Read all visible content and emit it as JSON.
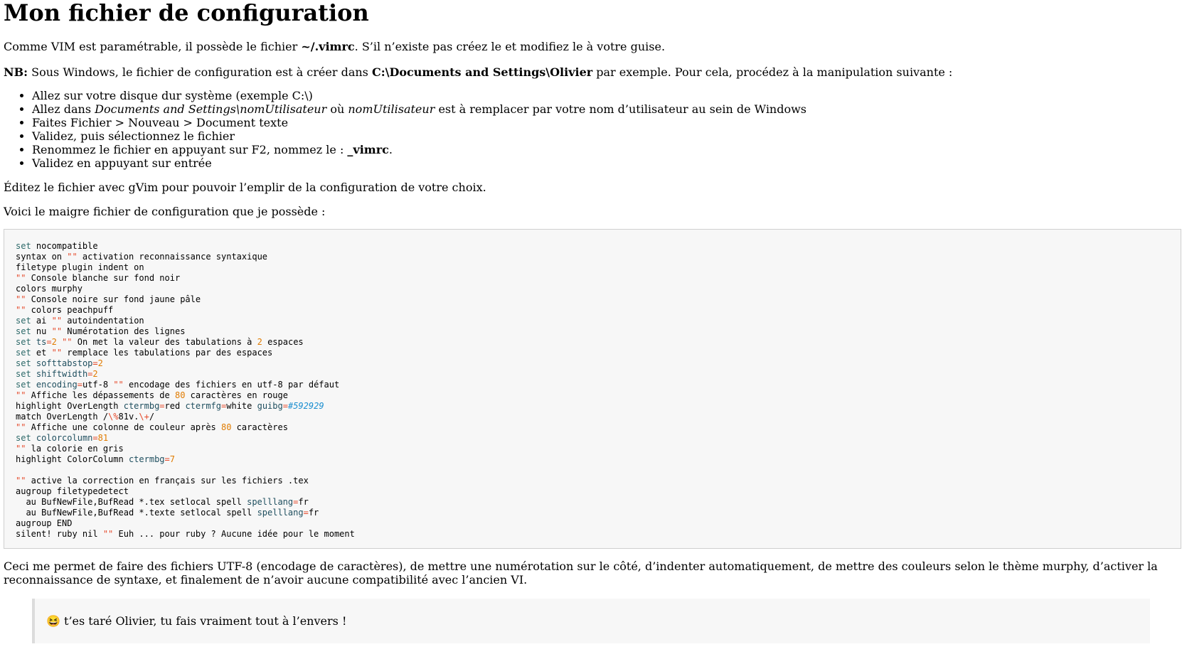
{
  "title": "Mon fichier de configuration",
  "intro": {
    "before": "Comme VIM est paramétrable, il possède le fichier ",
    "file": "~/.vimrc",
    "after": ". S’il n’existe pas créez le et modifiez le à votre guise."
  },
  "nb": {
    "label": "NB:",
    "before": " Sous Windows, le fichier de configuration est à créer dans ",
    "path": "C:\\Documents and Settings\\Olivier",
    "after": " par exemple. Pour cela, procédez à la manipulation suivante :"
  },
  "steps": {
    "s1": "Allez sur votre disque dur système (exemple C:\\)",
    "s2_a": "Allez dans ",
    "s2_b": "Documents and Settings\\nomUtilisateur",
    "s2_c": " où ",
    "s2_d": "nomUtilisateur",
    "s2_e": " est à remplacer par votre nom d’utilisateur au sein de Windows",
    "s3": "Faites Fichier > Nouveau > Document texte",
    "s4": "Validez, puis sélectionnez le fichier",
    "s5_a": "Renommez le fichier en appuyant sur F2, nommez le : ",
    "s5_b": "_vimrc",
    "s5_c": ".",
    "s6": "Validez en appuyant sur entrée"
  },
  "edit_text": "Éditez le fichier avec gVim pour pouvoir l’emplir de la configuration de votre choix.",
  "voici_text": "Voici le maigre fichier de configuration que je possède :",
  "code_lines": [
    [
      [
        "kw",
        "set"
      ],
      [
        "t",
        " nocompatible"
      ]
    ],
    [
      [
        "t",
        "syntax on "
      ],
      [
        "str",
        "\"\""
      ],
      [
        "t",
        " activation reconnaissance syntaxique"
      ]
    ],
    [
      [
        "t",
        "filetype plugin indent on"
      ]
    ],
    [
      [
        "str",
        "\"\""
      ],
      [
        "t",
        " Console blanche sur fond noir"
      ]
    ],
    [
      [
        "t",
        "colors murphy"
      ]
    ],
    [
      [
        "str",
        "\"\""
      ],
      [
        "t",
        " Console noire sur fond jaune pâle"
      ]
    ],
    [
      [
        "str",
        "\"\""
      ],
      [
        "t",
        " colors peachpuff"
      ]
    ],
    [
      [
        "kw",
        "set"
      ],
      [
        "t",
        " ai "
      ],
      [
        "str",
        "\"\""
      ],
      [
        "t",
        " autoindentation"
      ]
    ],
    [
      [
        "kw",
        "set"
      ],
      [
        "t",
        " nu "
      ],
      [
        "str",
        "\"\""
      ],
      [
        "t",
        " Numérotation des lignes"
      ]
    ],
    [
      [
        "kw",
        "set"
      ],
      [
        "t",
        " "
      ],
      [
        "var",
        "ts"
      ],
      [
        "str",
        "="
      ],
      [
        "num",
        "2"
      ],
      [
        "t",
        " "
      ],
      [
        "str",
        "\"\""
      ],
      [
        "t",
        " On met la valeur des tabulations à "
      ],
      [
        "num",
        "2"
      ],
      [
        "t",
        " espaces"
      ]
    ],
    [
      [
        "kw",
        "set"
      ],
      [
        "t",
        " et "
      ],
      [
        "str",
        "\"\""
      ],
      [
        "t",
        " remplace les tabulations par des espaces"
      ]
    ],
    [
      [
        "kw",
        "set"
      ],
      [
        "t",
        " "
      ],
      [
        "var",
        "softtabstop"
      ],
      [
        "str",
        "="
      ],
      [
        "num",
        "2"
      ]
    ],
    [
      [
        "kw",
        "set"
      ],
      [
        "t",
        " "
      ],
      [
        "var",
        "shiftwidth"
      ],
      [
        "str",
        "="
      ],
      [
        "num",
        "2"
      ]
    ],
    [
      [
        "kw",
        "set"
      ],
      [
        "t",
        " "
      ],
      [
        "var",
        "encoding"
      ],
      [
        "str",
        "="
      ],
      [
        "t",
        "utf-8 "
      ],
      [
        "str",
        "\"\""
      ],
      [
        "t",
        " encodage des fichiers en utf-8 par défaut"
      ]
    ],
    [
      [
        "str",
        "\"\""
      ],
      [
        "t",
        " Affiche les dépassements de "
      ],
      [
        "num",
        "80"
      ],
      [
        "t",
        " caractères en rouge"
      ]
    ],
    [
      [
        "t",
        "highlight OverLength "
      ],
      [
        "var",
        "ctermbg"
      ],
      [
        "str",
        "="
      ],
      [
        "t",
        "red "
      ],
      [
        "var",
        "ctermfg"
      ],
      [
        "str",
        "="
      ],
      [
        "t",
        "white "
      ],
      [
        "var",
        "guibg"
      ],
      [
        "str",
        "="
      ],
      [
        "hex",
        "#592929"
      ]
    ],
    [
      [
        "t",
        "match OverLength /"
      ],
      [
        "str",
        "\\%"
      ],
      [
        "t",
        "81v."
      ],
      [
        "str",
        "\\+"
      ],
      [
        "t",
        "/"
      ]
    ],
    [
      [
        "str",
        "\"\""
      ],
      [
        "t",
        " Affiche une colonne de couleur après "
      ],
      [
        "num",
        "80"
      ],
      [
        "t",
        " caractères"
      ]
    ],
    [
      [
        "kw",
        "set"
      ],
      [
        "t",
        " "
      ],
      [
        "var",
        "colorcolumn"
      ],
      [
        "str",
        "="
      ],
      [
        "num",
        "81"
      ]
    ],
    [
      [
        "str",
        "\"\""
      ],
      [
        "t",
        " la colorie en gris"
      ]
    ],
    [
      [
        "t",
        "highlight ColorColumn "
      ],
      [
        "var",
        "ctermbg"
      ],
      [
        "str",
        "="
      ],
      [
        "num",
        "7"
      ]
    ],
    [
      [
        "t",
        ""
      ]
    ],
    [
      [
        "str",
        "\"\""
      ],
      [
        "t",
        " active la correction en français sur les fichiers .tex"
      ]
    ],
    [
      [
        "t",
        "augroup filetypedetect"
      ]
    ],
    [
      [
        "t",
        "  au BufNewFile,BufRead *.tex setlocal spell "
      ],
      [
        "var",
        "spelllang"
      ],
      [
        "str",
        "="
      ],
      [
        "t",
        "fr"
      ]
    ],
    [
      [
        "t",
        "  au BufNewFile,BufRead *.texte setlocal spell "
      ],
      [
        "var",
        "spelllang"
      ],
      [
        "str",
        "="
      ],
      [
        "t",
        "fr"
      ]
    ],
    [
      [
        "t",
        "augroup END"
      ]
    ],
    [
      [
        "t",
        "silent! ruby nil "
      ],
      [
        "str",
        "\"\""
      ],
      [
        "t",
        " Euh ... pour ruby ? Aucune idée pour le moment"
      ]
    ]
  ],
  "ceci_text": "Ceci me permet de faire des fichiers UTF-8 (encodage de caractères), de mettre une numérotation sur le côté, d’indenter automatiquement, de mettre des couleurs selon le thème murphy, d’activer la reconnaissance de syntaxe, et finalement de n’avoir aucune compatibilité avec l’ancien VI.",
  "quote_emoji": "😆",
  "quote_text": " t’es taré Olivier, tu fais vraiment tout à l’envers !"
}
